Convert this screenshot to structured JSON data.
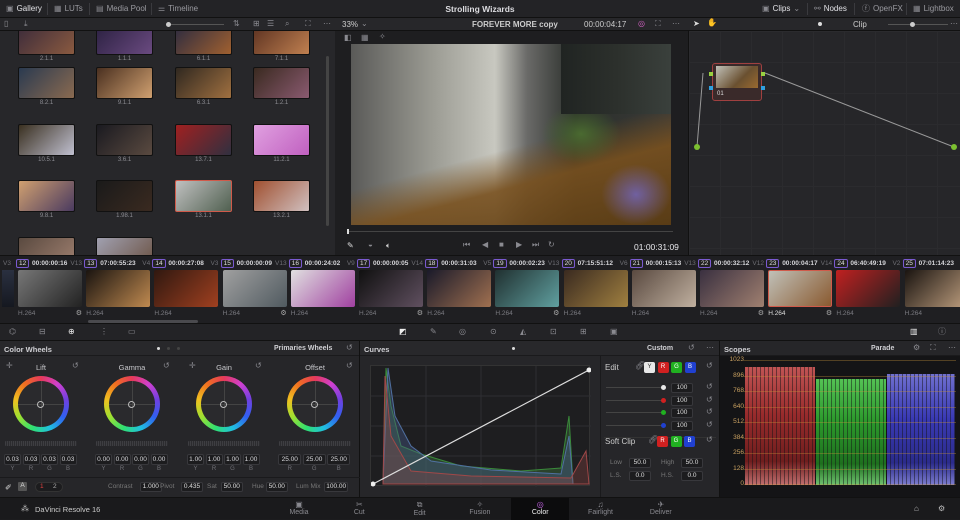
{
  "topbar": {
    "tabs": [
      {
        "label": "Gallery",
        "icon": "gallery-icon",
        "active": true
      },
      {
        "label": "LUTs",
        "icon": "luts-icon"
      },
      {
        "label": "Media Pool",
        "icon": "media-pool-icon"
      },
      {
        "label": "Timeline",
        "icon": "timeline-icon"
      }
    ],
    "project_title": "Strolling Wizards",
    "right_tabs": [
      {
        "label": "Clips",
        "icon": "clips-icon"
      },
      {
        "label": "Nodes",
        "icon": "nodes-icon"
      },
      {
        "label": "OpenFX",
        "icon": "openfx-icon"
      },
      {
        "label": "Lightbox",
        "icon": "lightbox-icon"
      }
    ]
  },
  "viewer": {
    "zoom": "33%",
    "timeline_name": "FOREVER MORE copy",
    "source_timecode": "00:00:04:17",
    "timecode": "01:00:31:09"
  },
  "node_editor": {
    "mode": "Clip",
    "node_label": "01"
  },
  "gallery": {
    "stills": [
      "2.1.1",
      "1.1.1",
      "6.1.1",
      "7.1.1",
      "8.2.1",
      "9.1.1",
      "6.3.1",
      "1.2.1",
      "10.5.1",
      "3.6.1",
      "13.7.1",
      "11.2.1",
      "9.8.1",
      "1.98.1",
      "13.1.1",
      "13.2.1",
      "",
      ""
    ],
    "selected": "13.1.1"
  },
  "clips": {
    "lead_track": "V3",
    "items": [
      {
        "num": "12",
        "tc": "00:00:00:16",
        "track": "V13",
        "codec": "H.264",
        "gear": true
      },
      {
        "num": "13",
        "tc": "07:00:55:23",
        "track": "V4",
        "codec": "H.264"
      },
      {
        "num": "14",
        "tc": "00:00:27:08",
        "track": "V3",
        "codec": "H.264"
      },
      {
        "num": "15",
        "tc": "00:00:00:09",
        "track": "V13",
        "codec": "H.264",
        "gear": true
      },
      {
        "num": "16",
        "tc": "00:00:24:02",
        "track": "V9",
        "codec": "H.264"
      },
      {
        "num": "17",
        "tc": "00:00:00:05",
        "track": "V14",
        "codec": "H.264",
        "gear": true
      },
      {
        "num": "18",
        "tc": "00:00:31:03",
        "track": "V5",
        "codec": "H.264"
      },
      {
        "num": "19",
        "tc": "00:00:02:23",
        "track": "V13",
        "codec": "H.264",
        "gear": true
      },
      {
        "num": "20",
        "tc": "07:15:51:12",
        "track": "V6",
        "codec": "H.264"
      },
      {
        "num": "21",
        "tc": "00:00:15:13",
        "track": "V13",
        "codec": "H.264"
      },
      {
        "num": "22",
        "tc": "00:00:32:12",
        "track": "V12",
        "codec": "H.264",
        "gear": true
      },
      {
        "num": "23",
        "tc": "00:00:04:17",
        "track": "V14",
        "codec": "H.264",
        "gear": true,
        "selected": true
      },
      {
        "num": "24",
        "tc": "06:40:49:19",
        "track": "V2",
        "codec": "H.264"
      },
      {
        "num": "25",
        "tc": "07:01:14:23",
        "track": "",
        "codec": "H.264"
      }
    ]
  },
  "color_wheels": {
    "title": "Color Wheels",
    "mode": "Primaries Wheels",
    "wheels": [
      {
        "name": "Lift",
        "values": [
          "0.03",
          "0.03",
          "0.03",
          "0.03"
        ],
        "channels": [
          "Y",
          "R",
          "G",
          "B"
        ]
      },
      {
        "name": "Gamma",
        "values": [
          "0.00",
          "0.00",
          "0.00",
          "0.00"
        ],
        "channels": [
          "Y",
          "R",
          "G",
          "B"
        ]
      },
      {
        "name": "Gain",
        "values": [
          "1.00",
          "1.00",
          "1.00",
          "1.00"
        ],
        "channels": [
          "Y",
          "R",
          "G",
          "B"
        ]
      },
      {
        "name": "Offset",
        "values": [
          "25.00",
          "25.00",
          "25.00"
        ],
        "channels": [
          "R",
          "G",
          "B"
        ]
      }
    ],
    "page1": "1",
    "page2": "2",
    "adjust": [
      {
        "label": "Contrast",
        "value": "1.000"
      },
      {
        "label": "Pivot",
        "value": "0.435"
      },
      {
        "label": "Sat",
        "value": "50.00"
      },
      {
        "label": "Hue",
        "value": "50.00"
      },
      {
        "label": "Lum Mix",
        "value": "100.00"
      }
    ]
  },
  "curves": {
    "title": "Curves",
    "mode": "Custom",
    "edit_label": "Edit",
    "channels": [
      "Y",
      "R",
      "G",
      "B"
    ],
    "intensity": [
      "100",
      "100",
      "100",
      "100"
    ],
    "soft_clip_label": "Soft Clip",
    "low_label": "Low",
    "low": "50.0",
    "high_label": "High",
    "high": "50.0",
    "ls_label": "L.S.",
    "ls": "0.0",
    "hs_label": "H.S.",
    "hs": "0.0"
  },
  "scopes": {
    "title": "Scopes",
    "mode": "Parade",
    "y_ticks": [
      "1023",
      "896",
      "768",
      "640",
      "512",
      "384",
      "256",
      "128",
      "0"
    ]
  },
  "bottom": {
    "app_name": "DaVinci Resolve 16",
    "pages": [
      "Media",
      "Cut",
      "Edit",
      "Fusion",
      "Color",
      "Fairlight",
      "Deliver"
    ],
    "active": "Color"
  },
  "colors": {
    "accent_selected": "#d05a4a",
    "red": "#e03030",
    "green": "#30c030",
    "blue": "#2050e0"
  }
}
